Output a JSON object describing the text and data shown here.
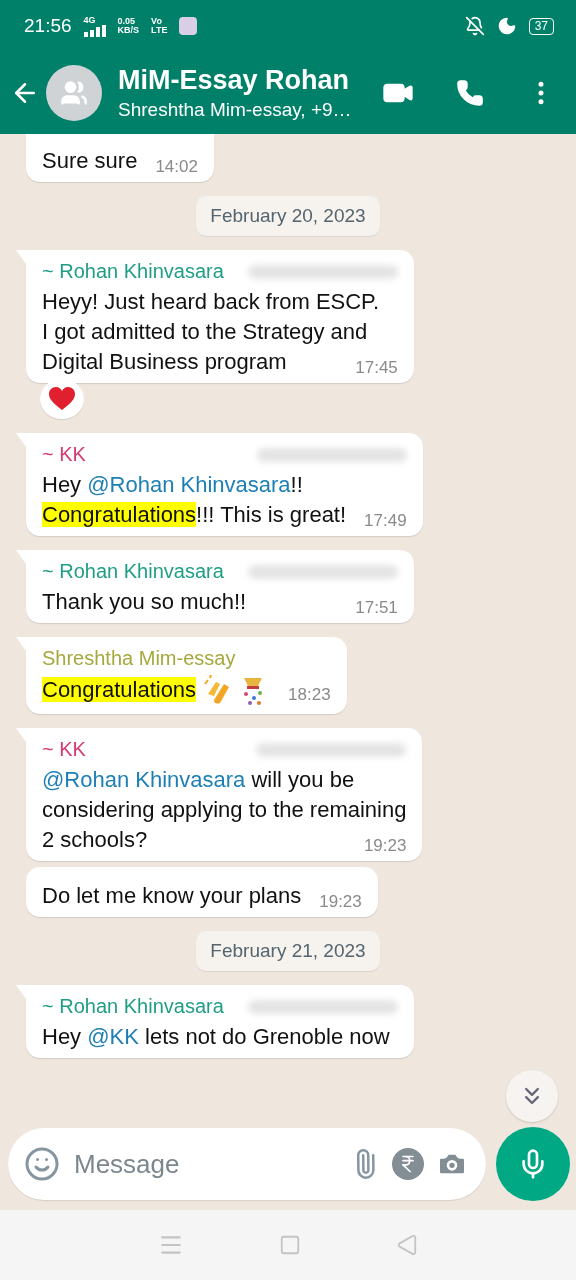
{
  "status_bar": {
    "time": "21:56",
    "network": "4G",
    "speed": "0.05",
    "speed_unit": "KB/S",
    "volte_top": "Vo",
    "volte_bottom": "LTE",
    "battery": "37"
  },
  "header": {
    "title": "MiM-Essay Rohan",
    "subtitle": "Shreshtha Mim-essay, +9…"
  },
  "chat": [
    {
      "kind": "message",
      "tail": false,
      "parts": [
        {
          "kind": "text",
          "text": "Sure sure"
        }
      ],
      "time": "14:02",
      "clipped_top": true
    },
    {
      "kind": "date",
      "text": "February 20, 2023"
    },
    {
      "kind": "message",
      "tail": true,
      "sender": "~ Rohan Khinvasara",
      "color": "#1f9e86",
      "number_hidden": true,
      "parts": [
        {
          "kind": "text",
          "text": "Heyy! Just heard back from ESCP.\nI got admitted to the Strategy and\nDigital Business program"
        }
      ],
      "time": "17:45",
      "reaction": true
    },
    {
      "kind": "message",
      "tail": true,
      "sender": "~ KK",
      "color": "#d63a72",
      "number_hidden": true,
      "parts": [
        {
          "kind": "text",
          "text": "Hey "
        },
        {
          "kind": "mention",
          "text": "@Rohan Khinvasara"
        },
        {
          "kind": "text",
          "text": "!!\n"
        },
        {
          "kind": "highlight",
          "text": "Congratulations"
        },
        {
          "kind": "text",
          "text": "!!! This is great!"
        }
      ],
      "time": "17:49"
    },
    {
      "kind": "message",
      "tail": true,
      "sender": "~ Rohan Khinvasara",
      "color": "#1f9e86",
      "number_hidden": true,
      "parts": [
        {
          "kind": "text",
          "text": "Thank you so much!!"
        }
      ],
      "time": "17:51"
    },
    {
      "kind": "message",
      "tail": true,
      "sender": "Shreshtha Mim-essay",
      "color": "#a5a83c",
      "number_hidden": false,
      "parts": [
        {
          "kind": "highlight",
          "text": "Congratulations"
        },
        {
          "kind": "clap"
        },
        {
          "kind": "confetti"
        }
      ],
      "time": "18:23"
    },
    {
      "kind": "message",
      "tail": true,
      "sender": "~ KK",
      "color": "#d63a72",
      "number_hidden": true,
      "parts": [
        {
          "kind": "mention",
          "text": "@Rohan Khinvasara"
        },
        {
          "kind": "text",
          "text": " will you be\nconsidering applying to the remaining\n2 schools?"
        }
      ],
      "time": "19:23"
    },
    {
      "kind": "message",
      "tail": false,
      "parts": [
        {
          "kind": "text",
          "text": "Do let me know your plans"
        }
      ],
      "time": "19:23"
    },
    {
      "kind": "date",
      "text": "February 21, 2023"
    },
    {
      "kind": "message",
      "tail": true,
      "sender": "~ Rohan Khinvasara",
      "color": "#1f9e86",
      "number_hidden": true,
      "parts": [
        {
          "kind": "text",
          "text": "Hey "
        },
        {
          "kind": "mention",
          "text": "@KK"
        },
        {
          "kind": "text",
          "text": " lets not do Grenoble now"
        }
      ]
    }
  ],
  "composer": {
    "placeholder": "Message"
  }
}
